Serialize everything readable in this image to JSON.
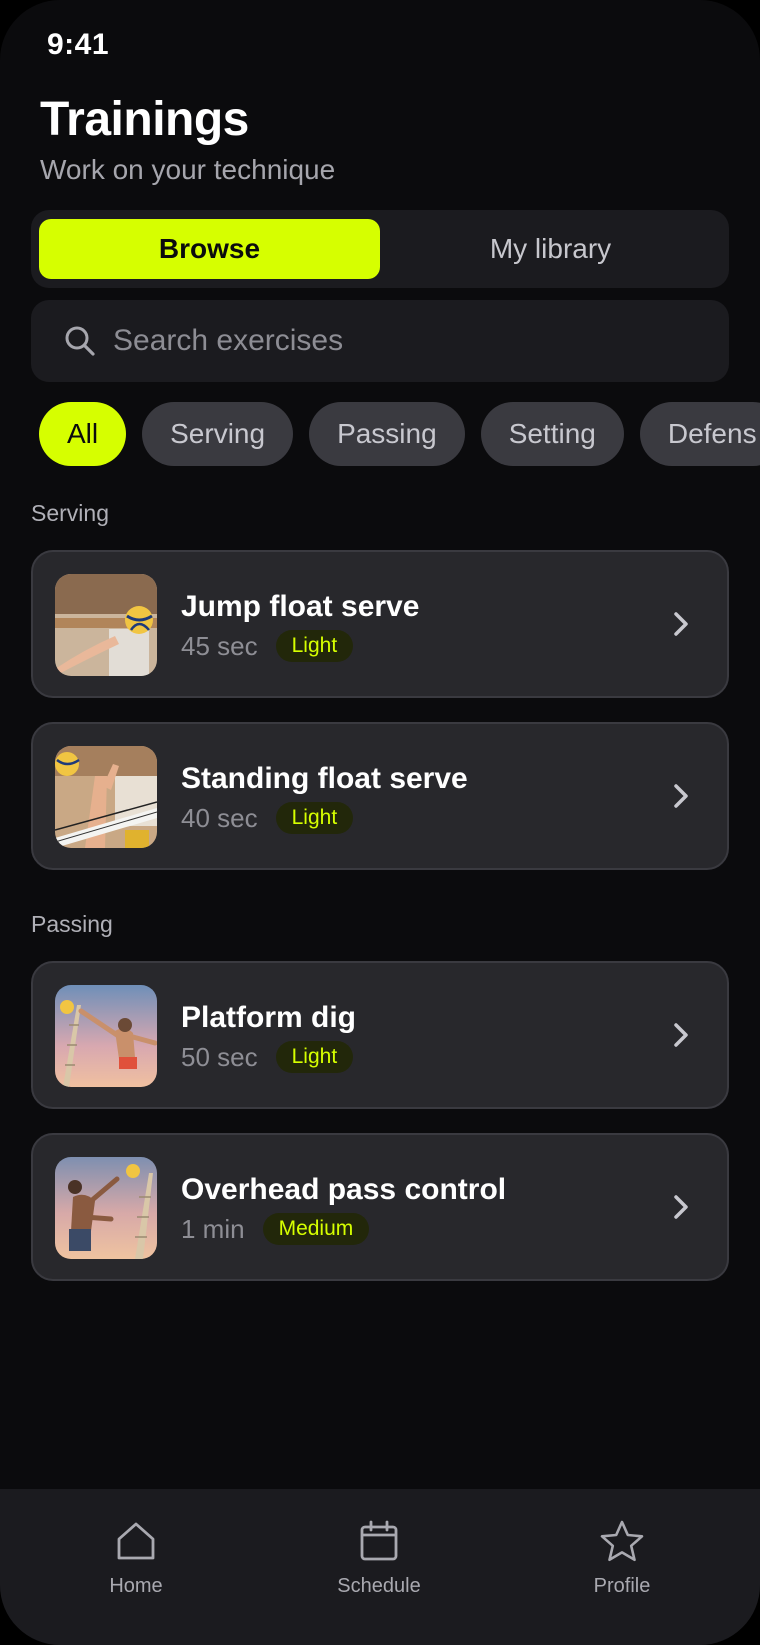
{
  "status_bar": {
    "time": "9:41"
  },
  "header": {
    "title": "Trainings",
    "subtitle": "Work on your technique"
  },
  "segmented": {
    "browse": "Browse",
    "library": "My library",
    "selected": "Browse"
  },
  "search": {
    "placeholder": "Search exercises",
    "value": ""
  },
  "filters": {
    "items": [
      "All",
      "Serving",
      "Passing",
      "Setting",
      "Defens"
    ],
    "selected": "All"
  },
  "sections": [
    {
      "label": "Serving",
      "items": [
        {
          "title": "Jump float serve",
          "duration": "45 sec",
          "level": "Light"
        },
        {
          "title": "Standing float serve",
          "duration": "40 sec",
          "level": "Light"
        }
      ]
    },
    {
      "label": "Passing",
      "items": [
        {
          "title": "Platform dig",
          "duration": "50 sec",
          "level": "Light"
        },
        {
          "title": "Overhead pass control",
          "duration": "1 min",
          "level": "Medium"
        }
      ]
    }
  ],
  "tabbar": {
    "home": "Home",
    "schedule": "Schedule",
    "profile": "Profile"
  },
  "colors": {
    "accent": "#d6ff00",
    "background": "#0b0b0d",
    "card": "#28282c"
  },
  "icons": [
    "search-icon",
    "chevron-right-icon",
    "home-icon",
    "calendar-icon",
    "star-icon"
  ]
}
